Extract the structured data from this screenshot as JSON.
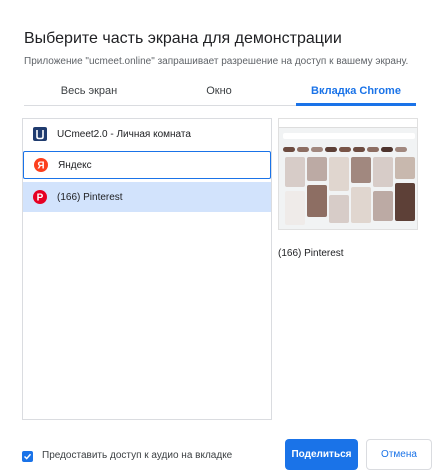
{
  "dialog": {
    "title": "Выберите часть экрана для демонстрации",
    "subtitle": "Приложение \"ucmeet.online\" запрашивает разрешение на доступ к вашему экрану."
  },
  "tabs": [
    {
      "label": "Весь экран",
      "active": false
    },
    {
      "label": "Окно",
      "active": false
    },
    {
      "label": "Вкладка Chrome",
      "active": true
    }
  ],
  "tab_list": [
    {
      "label": "UCmeet2.0 - Личная комната",
      "icon": "ucmeet-icon",
      "state": "normal"
    },
    {
      "label": "Яндекс",
      "icon": "yandex-icon",
      "state": "focused"
    },
    {
      "label": "(166) Pinterest",
      "icon": "pinterest-icon",
      "state": "selected"
    }
  ],
  "preview": {
    "caption": "(166) Pinterest"
  },
  "footer": {
    "audio_checkbox_checked": true,
    "audio_label": "Предоставить доступ к аудио на вкладке",
    "share_label": "Поделиться",
    "cancel_label": "Отмена"
  },
  "colors": {
    "accent": "#1a73e8",
    "selected_bg": "#d2e3fc",
    "yandex": "#fc3f1d",
    "pinterest": "#e60023"
  }
}
